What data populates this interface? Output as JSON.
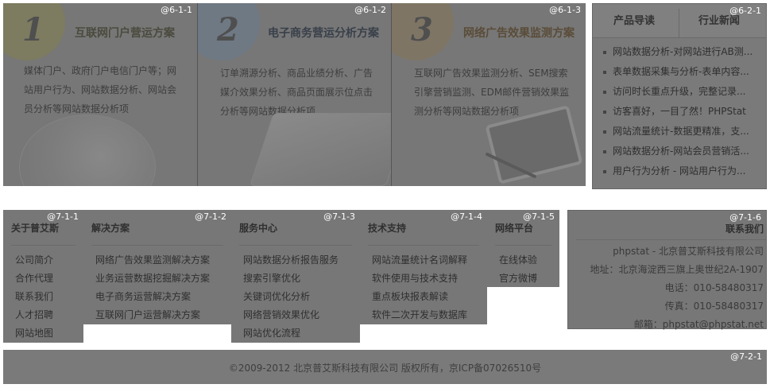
{
  "solutions": [
    {
      "tag": "@6-1-1",
      "num": "1",
      "title": "互联网门户营运方案",
      "desc": "媒体门户、政府门户电信门户等；网站用户行为、网站数据分析、网站会员分析等网站数据分析项"
    },
    {
      "tag": "@6-1-2",
      "num": "2",
      "title": "电子商务营运分析方案",
      "desc": "订单溯源分析、商品业绩分析、广告媒介效果分析、商品页面展示位点击分析等网站数据分析项"
    },
    {
      "tag": "@6-1-3",
      "num": "3",
      "title": "网络广告效果监测方案",
      "desc": "互联网广告效果监测分析、SEM搜索引擎营销监测、EDM邮件营销效果监测分析等网站数据分析项"
    }
  ],
  "guide": {
    "tag": "@6-2-1",
    "tab1": "产品导读",
    "tab2": "行业新闻",
    "items": [
      "网站数据分析-对网站进行AB测...",
      "表单数据采集与分析-表单内容...",
      "访问时长重点升级，完整记录...",
      "访客喜好，一目了然！PHPStat",
      "网站流量统计-数据更精准，支...",
      "网站数据分析-网站会员营销活...",
      "用户行为分析 - 网站用户行为..."
    ]
  },
  "footer": {
    "c1": {
      "tag": "@7-1-1",
      "title": "关于普艾斯",
      "items": [
        "公司简介",
        "合作代理",
        "联系我们",
        "人才招聘",
        "网站地图"
      ]
    },
    "c2": {
      "tag": "@7-1-2",
      "title": "解决方案",
      "items": [
        "网络广告效果监测解决方案",
        "业务运营数据挖掘解决方案",
        "电子商务运营解决方案",
        "互联网门户运营解决方案"
      ]
    },
    "c3": {
      "tag": "@7-1-3",
      "title": "服务中心",
      "items": [
        "网站数据分析报告服务",
        "搜索引擎优化",
        "关键词优化分析",
        "网络营销效果优化",
        "网站优化流程"
      ]
    },
    "c4": {
      "tag": "@7-1-4",
      "title": "技术支持",
      "items": [
        "网站流量统计名词解释",
        "软件使用与技术支持",
        "重点板块报表解读",
        "软件二次开发与数据库"
      ]
    },
    "c5": {
      "tag": "@7-1-5",
      "title": "网络平台",
      "items": [
        "在线体验",
        "官方微博"
      ]
    },
    "c6": {
      "tag": "@7-1-6",
      "title": "联系我们",
      "lines": [
        "phpstat - 北京普艾斯科技有限公司",
        "地址：北京海淀西三旗上奥世纪2A-1907",
        "电话：010-58480317",
        "传真：010-58480317",
        "邮箱：phpstat@phpstat.net"
      ]
    }
  },
  "copyright": {
    "tag": "@7-2-1",
    "text": "©2009-2012 北京普艾斯科技有限公司 版权所有，京ICP备07026510号"
  }
}
